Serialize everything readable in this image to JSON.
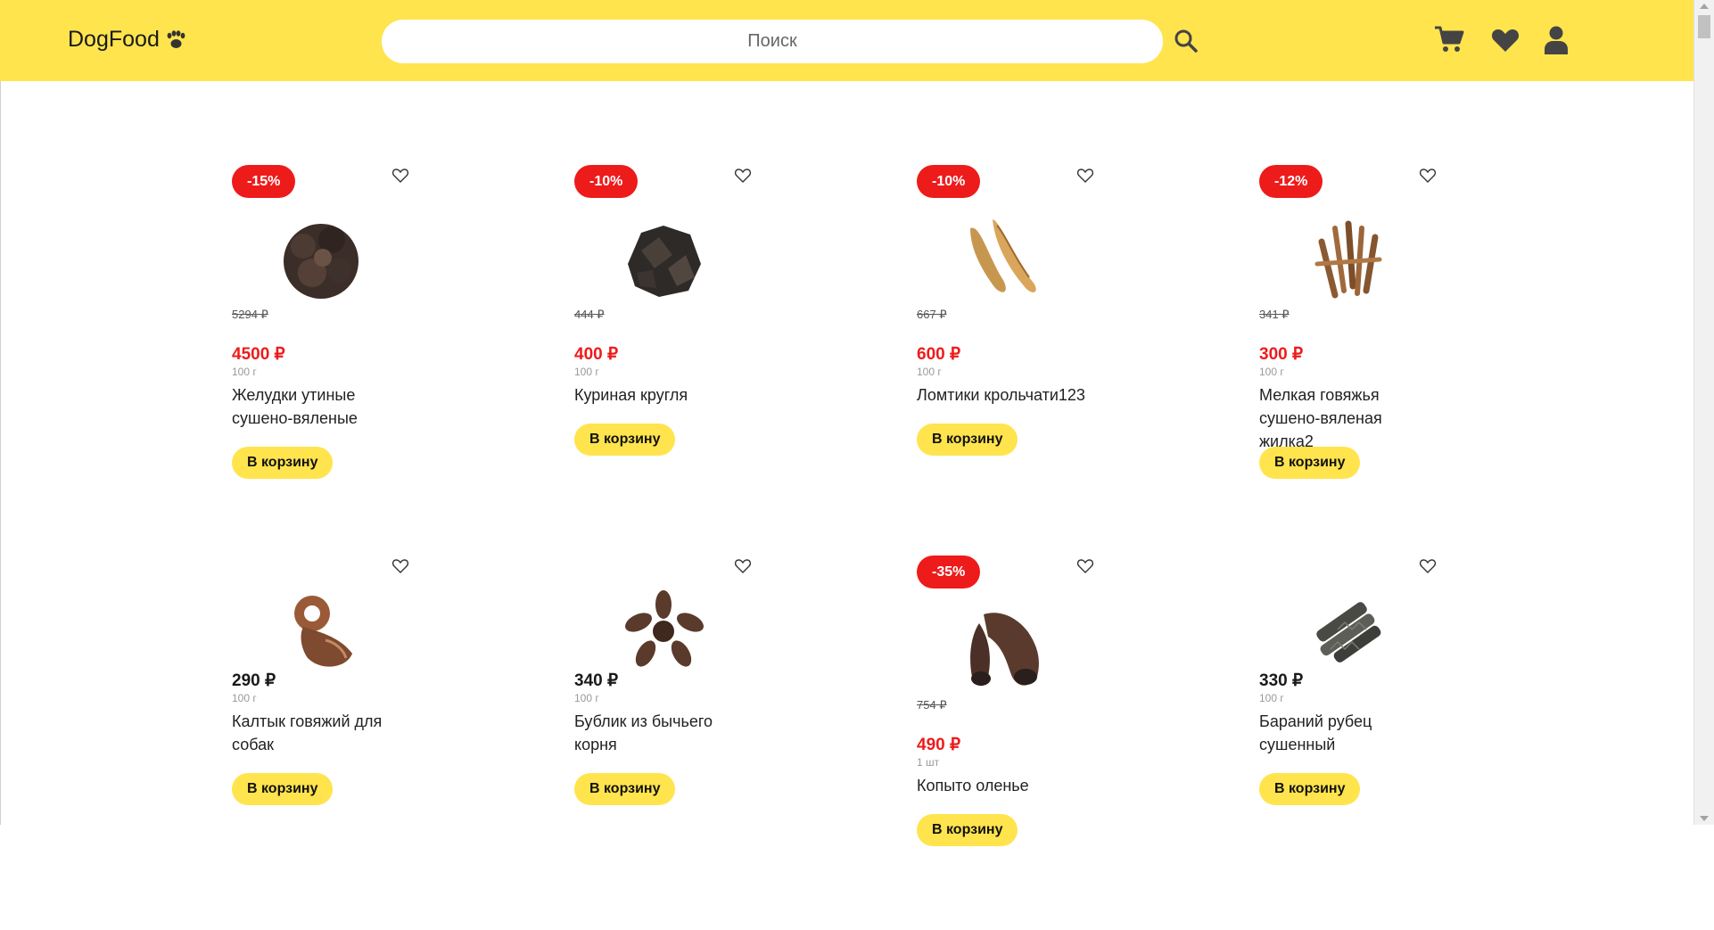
{
  "header": {
    "logo_text": "DogFood",
    "search_placeholder": "Поиск"
  },
  "colors": {
    "accent": "#ffe44d",
    "sale": "#ee1b1b"
  },
  "products": [
    {
      "discount": "-15%",
      "old_price": "5294 ₽",
      "price": "4500 ₽",
      "weight": "100 г",
      "name": "Желудки утиные сушено-вяленые",
      "button": "В корзину"
    },
    {
      "discount": "-10%",
      "old_price": "444 ₽",
      "price": "400 ₽",
      "weight": "100 г",
      "name": "Куриная кругля",
      "button": "В корзину"
    },
    {
      "discount": "-10%",
      "old_price": "667 ₽",
      "price": "600 ₽",
      "weight": "100 г",
      "name": "Ломтики крольчати123",
      "button": "В корзину"
    },
    {
      "discount": "-12%",
      "old_price": "341 ₽",
      "price": "300 ₽",
      "weight": "100 г",
      "name": "Мелкая говяжья сушено-вяленая жилка2",
      "button": "В корзину"
    },
    {
      "price": "290 ₽",
      "weight": "100 г",
      "name": "Калтык говяжий для собак",
      "button": "В корзину"
    },
    {
      "price": "340 ₽",
      "weight": "100 г",
      "name": "Бублик из бычьего корня",
      "button": "В корзину"
    },
    {
      "discount": "-35%",
      "old_price": "754 ₽",
      "price": "490 ₽",
      "weight": "1 шт",
      "name": "Копыто оленье",
      "button": "В корзину"
    },
    {
      "price": "330 ₽",
      "weight": "100 г",
      "name": "Бараний рубец сушенный",
      "button": "В корзину"
    }
  ]
}
